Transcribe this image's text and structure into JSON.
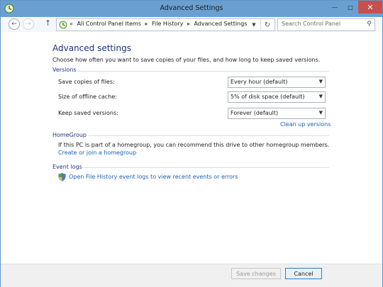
{
  "window": {
    "title": "Advanced Settings"
  },
  "address": {
    "prefix": "«",
    "crumbs": [
      "All Control Panel Items",
      "File History",
      "Advanced Settings"
    ]
  },
  "search": {
    "placeholder": "Search Control Panel"
  },
  "page": {
    "heading": "Advanced settings",
    "description": "Choose how often you want to save copies of your files, and how long to keep saved versions."
  },
  "versions": {
    "title": "Versions",
    "rows": [
      {
        "label": "Save copies of files:",
        "value": "Every hour (default)"
      },
      {
        "label": "Size of offline cache:",
        "value": "5% of disk space (default)"
      },
      {
        "label": "Keep saved versions:",
        "value": "Forever (default)"
      }
    ],
    "cleanup_link": "Clean up versions"
  },
  "homegroup": {
    "title": "HomeGroup",
    "text": "If this PC is part of a homegroup, you can recommend this drive to other homegroup members.",
    "link": "Create or join a homegroup"
  },
  "eventlogs": {
    "title": "Event logs",
    "link": "Open File History event logs to view recent events or errors"
  },
  "buttons": {
    "save": "Save changes",
    "cancel": "Cancel"
  }
}
